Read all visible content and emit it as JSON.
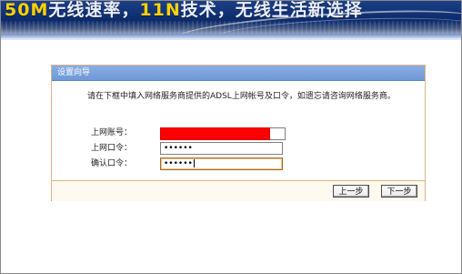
{
  "banner": {
    "slogan_part1": "50M",
    "slogan_part2": "无线速率，",
    "slogan_part3": "11N",
    "slogan_part4": "技术，无线生活新选择"
  },
  "panel": {
    "title": "设置向导",
    "description": "请在下框中填入网络服务商提供的ADSL上网帐号及口令，如遗忘请咨询网络服务商。",
    "fields": {
      "account": {
        "label": "上网账号：",
        "value": ""
      },
      "password": {
        "label": "上网口令：",
        "value": "••••••"
      },
      "confirm": {
        "label": "确认口令：",
        "value": "••••••"
      }
    },
    "buttons": {
      "prev": "上一步",
      "next": "下一步"
    }
  },
  "colors": {
    "header_blue": "#7aa2de",
    "panel_border": "#d9b48a",
    "redaction": "#ff0000"
  }
}
